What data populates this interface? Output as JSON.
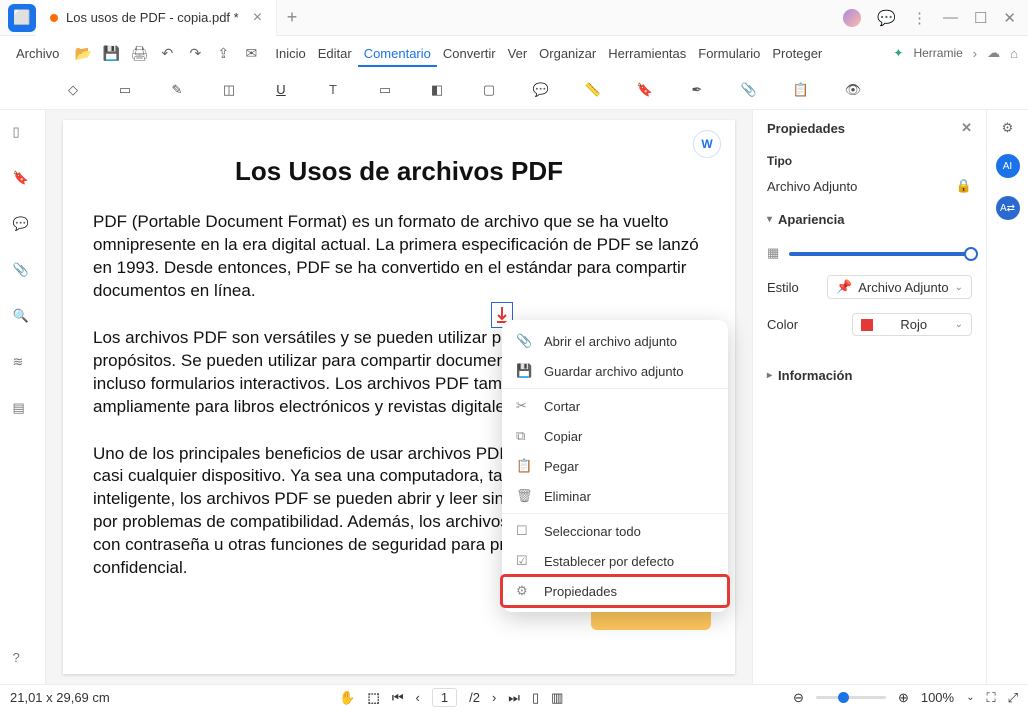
{
  "titlebar": {
    "tab_title": "Los usos de PDF - copia.pdf *"
  },
  "menubar": {
    "file": "Archivo",
    "items": [
      "Inicio",
      "Editar",
      "Comentario",
      "Convertir",
      "Ver",
      "Organizar",
      "Herramientas",
      "Formulario",
      "Proteger"
    ],
    "active": "Comentario",
    "right_hint": "Herramie"
  },
  "leftbar_icons": [
    "page-icon",
    "bookmark-icon",
    "comment-icon",
    "attachment-icon",
    "search-icon",
    "layers-icon",
    "form-icon"
  ],
  "document": {
    "title": "Los Usos de archivos PDF",
    "p1": "PDF (Portable Document Format) es un formato de archivo que se ha vuelto omnipresente en la era digital actual. La primera especificación de PDF se lanzó en 1993. Desde entonces, PDF se ha convertido en el estándar para compartir documentos en línea.",
    "p2": "Los archivos PDF son versátiles y se pueden utilizar para una amplia gama de propósitos. Se pueden utilizar para compartir documentos de texto, imágenes e incluso formularios interactivos. Los archivos PDF también se utilizan ampliamente para libros electrónicos y revistas digitales.",
    "p3": "Uno de los principales beneficios de usar archivos PDF es que se pueden ver en casi cualquier dispositivo. Ya sea una computadora, tableta o teléfono inteligente, los archivos PDF se pueden abrir y leer sin tener que preocuparse por problemas de compatibilidad. Además, los archivos PDF se pueden proteger con contraseña u otras funciones de seguridad para proteger la información confidencial."
  },
  "context_menu": {
    "items": [
      {
        "icon": "📎",
        "label": "Abrir el archivo adjunto"
      },
      {
        "icon": "💾",
        "label": "Guardar archivo adjunto"
      },
      {
        "sep": true
      },
      {
        "icon": "✂",
        "label": "Cortar"
      },
      {
        "icon": "⧉",
        "label": "Copiar"
      },
      {
        "icon": "📋",
        "label": "Pegar"
      },
      {
        "icon": "🗑",
        "label": "Eliminar"
      },
      {
        "sep": true
      },
      {
        "icon": "☐",
        "label": "Seleccionar todo"
      },
      {
        "icon": "☑",
        "label": "Establecer por defecto"
      },
      {
        "icon": "⚙",
        "label": "Propiedades",
        "highlight": true
      }
    ]
  },
  "rpanel": {
    "title": "Propiedades",
    "type_label": "Tipo",
    "type_value": "Archivo Adjunto",
    "appearance": "Apariencia",
    "estilo_label": "Estilo",
    "estilo_value": "Archivo Adjunto",
    "color_label": "Color",
    "color_value": "Rojo",
    "informacion": "Información"
  },
  "statusbar": {
    "coords": "21,01 x 29,69 cm",
    "page_current": "1",
    "page_total": "/2",
    "zoom": "100%"
  }
}
